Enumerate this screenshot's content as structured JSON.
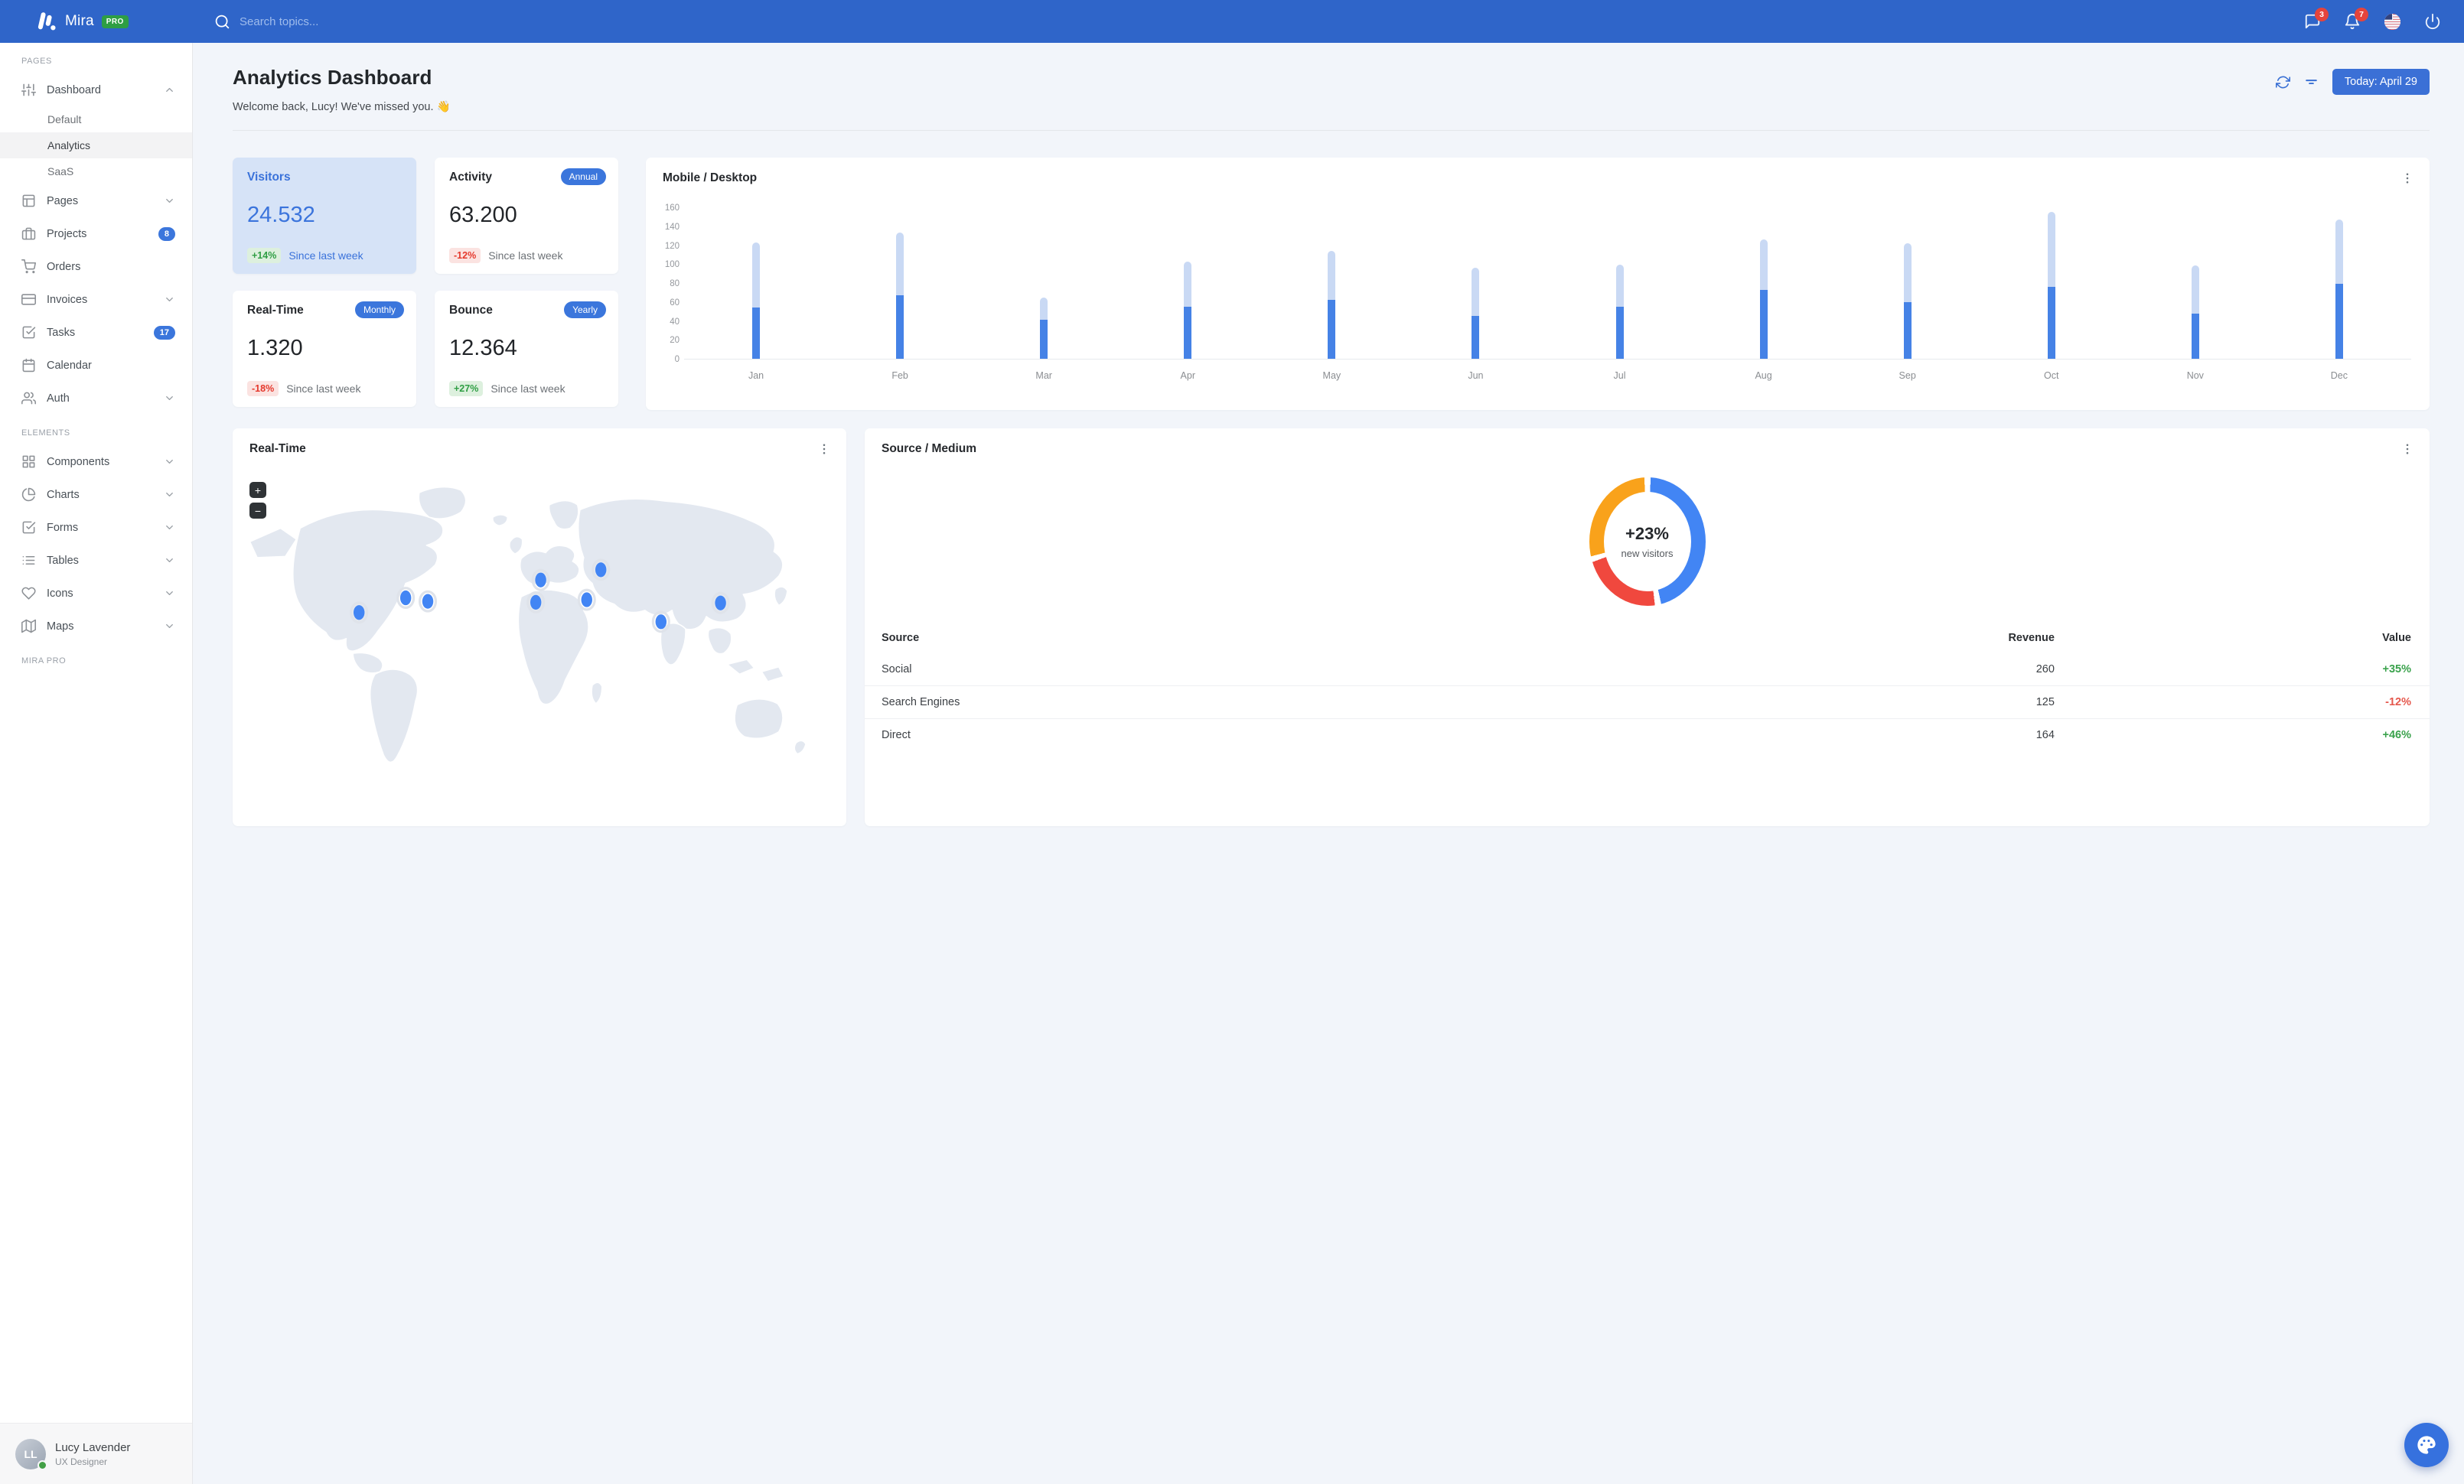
{
  "navbar": {
    "brand": "Mira",
    "brand_badge": "PRO",
    "search_placeholder": "Search topics...",
    "messages_count": "3",
    "notifications_count": "7"
  },
  "sidebar": {
    "sections": [
      {
        "label": "Pages",
        "items": [
          {
            "label": "Dashboard",
            "icon": "sliders-icon",
            "chevron": "up",
            "children": [
              {
                "label": "Default"
              },
              {
                "label": "Analytics",
                "active": true
              },
              {
                "label": "SaaS"
              }
            ]
          },
          {
            "label": "Pages",
            "icon": "layout-icon",
            "chevron": "down"
          },
          {
            "label": "Projects",
            "icon": "briefcase-icon",
            "badge": "8"
          },
          {
            "label": "Orders",
            "icon": "shopping-cart-icon"
          },
          {
            "label": "Invoices",
            "icon": "credit-card-icon",
            "chevron": "down"
          },
          {
            "label": "Tasks",
            "icon": "check-square-icon",
            "badge": "17"
          },
          {
            "label": "Calendar",
            "icon": "calendar-icon"
          },
          {
            "label": "Auth",
            "icon": "users-icon",
            "chevron": "down"
          }
        ]
      },
      {
        "label": "Elements",
        "items": [
          {
            "label": "Components",
            "icon": "grid-icon",
            "chevron": "down"
          },
          {
            "label": "Charts",
            "icon": "pie-chart-icon",
            "chevron": "down"
          },
          {
            "label": "Forms",
            "icon": "check-square-icon",
            "chevron": "down"
          },
          {
            "label": "Tables",
            "icon": "list-icon",
            "chevron": "down"
          },
          {
            "label": "Icons",
            "icon": "heart-icon",
            "chevron": "down"
          },
          {
            "label": "Maps",
            "icon": "map-icon",
            "chevron": "down"
          }
        ]
      },
      {
        "label": "Mira Pro",
        "items": []
      }
    ],
    "user": {
      "name": "Lucy Lavender",
      "role": "UX Designer",
      "status": "online"
    }
  },
  "header": {
    "title": "Analytics Dashboard",
    "subtitle": "Welcome back, Lucy! We've missed you. 👋",
    "date_button": "Today: April 29"
  },
  "stats": [
    {
      "title": "Visitors",
      "value": "24.532",
      "delta": "+14%",
      "delta_type": "positive",
      "caption": "Since last week",
      "variant": "primary"
    },
    {
      "title": "Activity",
      "value": "63.200",
      "delta": "-12%",
      "delta_type": "negative",
      "caption": "Since last week",
      "tag": "Annual"
    },
    {
      "title": "Real-Time",
      "value": "1.320",
      "delta": "-18%",
      "delta_type": "negative",
      "caption": "Since last week",
      "tag": "Monthly"
    },
    {
      "title": "Bounce",
      "value": "12.364",
      "delta": "+27%",
      "delta_type": "positive",
      "caption": "Since last week",
      "tag": "Yearly"
    }
  ],
  "chart_data": [
    {
      "type": "bar",
      "title": "Mobile / Desktop",
      "stacked": true,
      "categories": [
        "Jan",
        "Feb",
        "Mar",
        "Apr",
        "May",
        "Jun",
        "Jul",
        "Aug",
        "Sep",
        "Oct",
        "Nov",
        "Dec"
      ],
      "series": [
        {
          "name": "Mobile",
          "color": "#4582e6",
          "values": [
            54,
            67,
            41,
            55,
            62,
            45,
            55,
            73,
            60,
            76,
            48,
            79
          ]
        },
        {
          "name": "Desktop",
          "color": "#c9d9f4",
          "values": [
            69,
            66,
            24,
            48,
            52,
            51,
            44,
            53,
            62,
            79,
            51,
            68
          ]
        }
      ],
      "ylabel": "",
      "xlabel": "",
      "ylim": [
        0,
        160
      ],
      "yticks": [
        0,
        20,
        40,
        60,
        80,
        100,
        120,
        140,
        160
      ],
      "grid": false,
      "legend": "none"
    },
    {
      "type": "pie",
      "title": "Source / Medium",
      "donut": true,
      "center_label": "+23%",
      "center_sublabel": "new visitors",
      "segments": [
        {
          "label": "Social",
          "value": 260,
          "color": "#4285f4"
        },
        {
          "label": "Search Engines",
          "value": 125,
          "color": "#f0483e"
        },
        {
          "label": "Direct",
          "value": 164,
          "color": "#f9a21b"
        }
      ]
    }
  ],
  "map_card": {
    "title": "Real-Time",
    "zoom_in_label": "+",
    "zoom_out_label": "−",
    "markers": [
      {
        "x": 20.6,
        "y": 44.9
      },
      {
        "x": 28.2,
        "y": 40.3
      },
      {
        "x": 31.8,
        "y": 41.4
      },
      {
        "x": 50.2,
        "y": 34.7
      },
      {
        "x": 49.4,
        "y": 41.7
      },
      {
        "x": 60.0,
        "y": 31.5
      },
      {
        "x": 57.7,
        "y": 40.9
      },
      {
        "x": 69.8,
        "y": 47.8
      },
      {
        "x": 79.5,
        "y": 41.9
      }
    ]
  },
  "source_table": {
    "headers": [
      "Source",
      "Revenue",
      "Value"
    ],
    "rows": [
      {
        "source": "Social",
        "revenue": "260",
        "value": "+35%",
        "value_type": "positive"
      },
      {
        "source": "Search Engines",
        "revenue": "125",
        "value": "-12%",
        "value_type": "negative"
      },
      {
        "source": "Direct",
        "revenue": "164",
        "value": "+46%",
        "value_type": "positive"
      }
    ]
  },
  "colors": {
    "navbar": "#2f65c9",
    "primary": "#3b76dc",
    "positive": "#2f9e44",
    "negative": "#e5382c",
    "stat_primary_bg": "#d6e3f7",
    "bar_dark": "#4582e6",
    "bar_light": "#c9d9f4",
    "map_land": "#e3e8f0",
    "badge_red": "#e5443c",
    "pro_green": "#2e9e44"
  }
}
